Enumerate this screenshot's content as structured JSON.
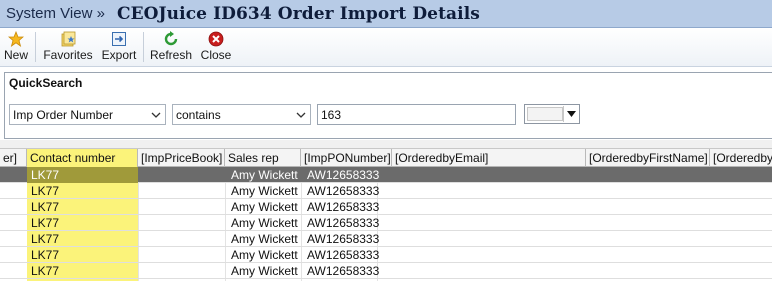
{
  "titlebar": {
    "crumb": "System View »",
    "title": "CEOJuice ID634 Order Import Details"
  },
  "toolbar": {
    "new": "New",
    "favorites": "Favorites",
    "export": "Export",
    "refresh": "Refresh",
    "close": "Close"
  },
  "quicksearch": {
    "title": "QuickSearch",
    "field": "Imp Order Number",
    "operator": "contains",
    "value": "163"
  },
  "grid": {
    "columns": [
      "er]",
      "Contact number",
      "[ImpPriceBook]",
      "Sales rep",
      "[ImpPONumber]",
      "[OrderedbyEmail]",
      "[OrderedbyFirstName]",
      "[OrderedbyL"
    ],
    "rows": [
      {
        "contact": "LK77",
        "salesrep": "Amy Wickett",
        "po": "AW12658333"
      },
      {
        "contact": "LK77",
        "salesrep": "Amy Wickett",
        "po": "AW12658333"
      },
      {
        "contact": "LK77",
        "salesrep": "Amy Wickett",
        "po": "AW12658333"
      },
      {
        "contact": "LK77",
        "salesrep": "Amy Wickett",
        "po": "AW12658333"
      },
      {
        "contact": "LK77",
        "salesrep": "Amy Wickett",
        "po": "AW12658333"
      },
      {
        "contact": "LK77",
        "salesrep": "Amy Wickett",
        "po": "AW12658333"
      },
      {
        "contact": "LK77",
        "salesrep": "Amy Wickett",
        "po": "AW12658333"
      }
    ]
  },
  "colors": {
    "titlebar": "#b7cbe6",
    "highlight": "#fbf37a",
    "selected_row": "#6b6b6b"
  }
}
